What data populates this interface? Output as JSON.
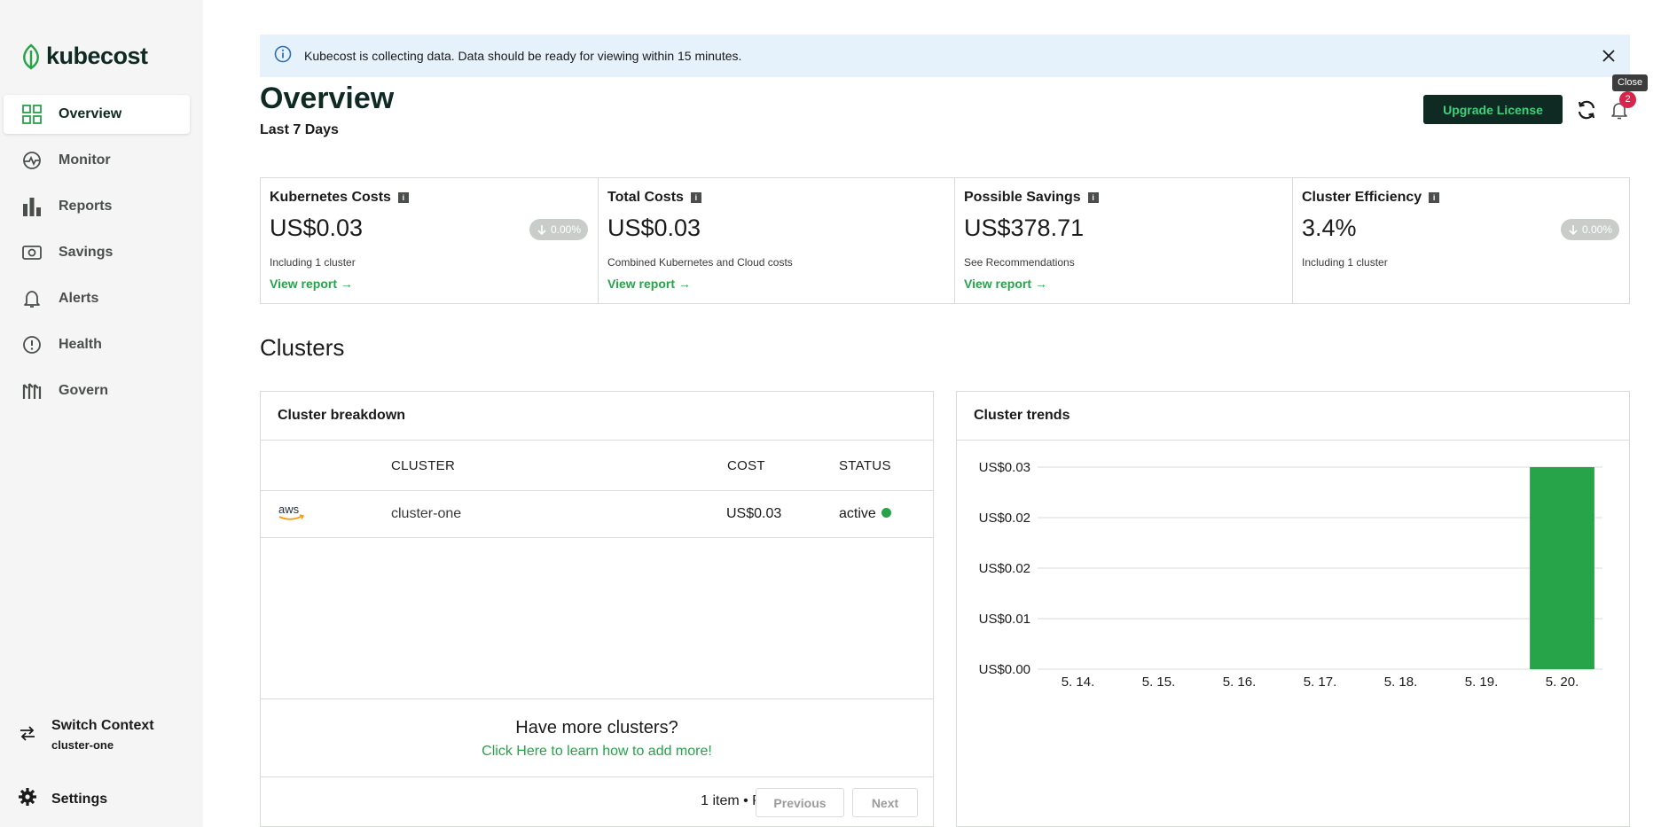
{
  "app": {
    "name": "kubecost"
  },
  "sidebar": {
    "items": [
      {
        "label": "Overview",
        "icon": "grid-icon",
        "active": true
      },
      {
        "label": "Monitor",
        "icon": "monitor-icon"
      },
      {
        "label": "Reports",
        "icon": "bar-chart-icon"
      },
      {
        "label": "Savings",
        "icon": "money-icon"
      },
      {
        "label": "Alerts",
        "icon": "bell-icon"
      },
      {
        "label": "Health",
        "icon": "alert-circle-icon"
      },
      {
        "label": "Govern",
        "icon": "gauge-icon"
      }
    ],
    "switch_context": {
      "label": "Switch Context",
      "cluster": "cluster-one"
    },
    "settings_label": "Settings"
  },
  "banner": {
    "text": "Kubecost is collecting data. Data should be ready for viewing within 15 minutes.",
    "tooltip": "Close"
  },
  "header": {
    "title": "Overview",
    "subtitle": "Last 7 Days",
    "upgrade_label": "Upgrade License",
    "notification_count": "2"
  },
  "stats": [
    {
      "title": "Kubernetes Costs",
      "value": "US$0.03",
      "delta": "0.00%",
      "note": "Including 1 cluster",
      "link": "View report →"
    },
    {
      "title": "Total Costs",
      "value": "US$0.03",
      "delta": "",
      "note": "Combined Kubernetes and Cloud costs",
      "link": "View report →"
    },
    {
      "title": "Possible Savings",
      "value": "US$378.71",
      "delta": "",
      "note": "See Recommendations",
      "link": "View report →"
    },
    {
      "title": "Cluster Efficiency",
      "value": "3.4%",
      "delta": "0.00%",
      "note": "Including 1 cluster",
      "link": ""
    }
  ],
  "clusters": {
    "section_title": "Clusters",
    "breakdown": {
      "title": "Cluster breakdown",
      "columns": [
        "CLUSTER",
        "COST",
        "STATUS"
      ],
      "rows": [
        {
          "provider": "aws",
          "cluster": "cluster-one",
          "cost": "US$0.03",
          "status": "active"
        }
      ],
      "more_title": "Have more clusters?",
      "more_link": "Click Here to learn how to add more!",
      "pager_text": "1 item • Page 1 of 1",
      "prev_label": "Previous",
      "next_label": "Next"
    },
    "trends": {
      "title": "Cluster trends"
    }
  },
  "chart_data": {
    "type": "bar",
    "title": "Cluster trends",
    "categories": [
      "5. 14.",
      "5. 15.",
      "5. 16.",
      "5. 17.",
      "5. 18.",
      "5. 19.",
      "5. 20."
    ],
    "values": [
      0,
      0,
      0,
      0,
      0,
      0,
      0.03
    ],
    "y_ticks": [
      "US$0.00",
      "US$0.01",
      "US$0.02",
      "US$0.02",
      "US$0.03"
    ],
    "ylim": [
      0,
      0.03
    ],
    "grid": true,
    "bar_color": "#27a349"
  },
  "colors": {
    "brand_dark": "#0e2a22",
    "accent_green": "#27a349",
    "banner_bg": "#e5f1fb",
    "badge_red": "#d6244a"
  }
}
